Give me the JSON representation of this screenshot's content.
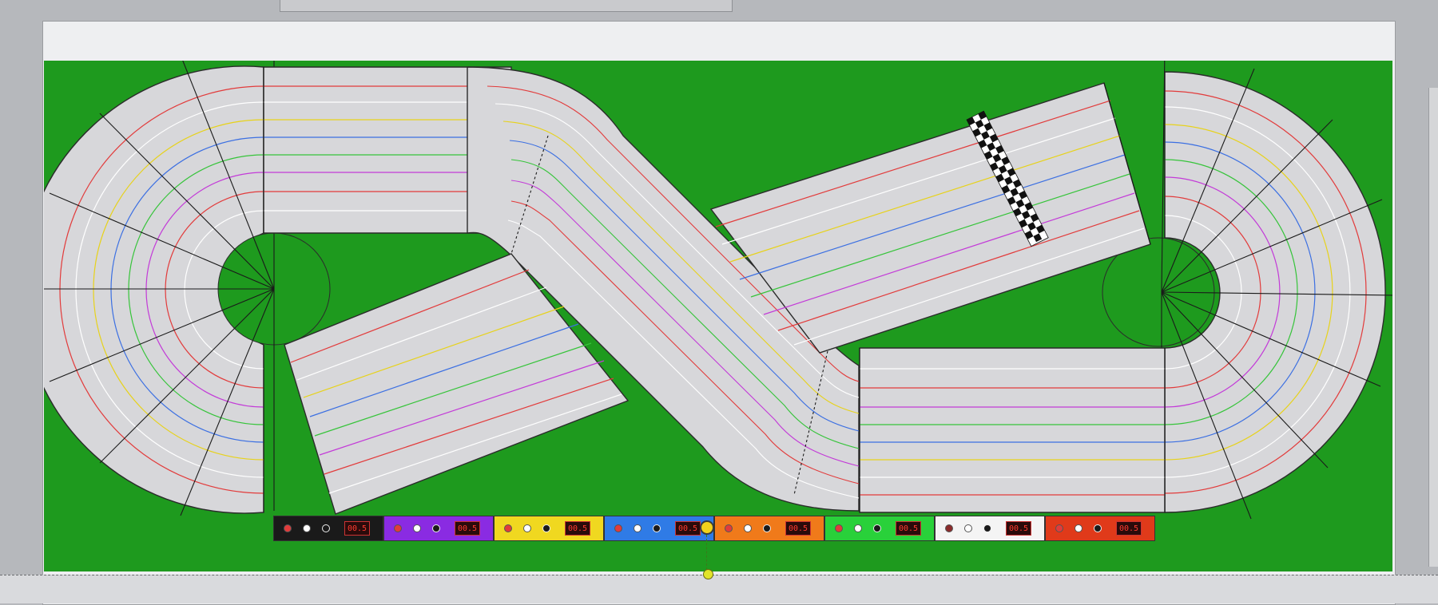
{
  "colors": {
    "grass": "#1e9a1e",
    "track": "#d7d7da",
    "track_edge": "#2b2b2b",
    "lane_lines": [
      "#e23b3b",
      "#ffffff",
      "#e7d21a",
      "#3b6fe2",
      "#36c43a",
      "#c33bd8"
    ],
    "finish_dark": "#111111",
    "finish_light": "#ffffff"
  },
  "lanes": [
    {
      "id": "lane-1",
      "color": "#1a1a1a",
      "dots": [
        "#e23b3b",
        "#ffffff",
        "#1a1a1a"
      ],
      "timer": "00.5"
    },
    {
      "id": "lane-2",
      "color": "#8a2be2",
      "dots": [
        "#e23b3b",
        "#ffffff",
        "#1a1a1a"
      ],
      "timer": "00.5"
    },
    {
      "id": "lane-3",
      "color": "#f0d820",
      "dots": [
        "#e23b3b",
        "#ffffff",
        "#1a1a1a"
      ],
      "timer": "00.5"
    },
    {
      "id": "lane-4",
      "color": "#2f7be6",
      "dots": [
        "#e23b3b",
        "#ffffff",
        "#1a1a1a"
      ],
      "timer": "00.5"
    },
    {
      "id": "lane-5",
      "color": "#f07a1a",
      "dots": [
        "#e23b3b",
        "#ffffff",
        "#1a1a1a"
      ],
      "timer": "00.5"
    },
    {
      "id": "lane-6",
      "color": "#29d13a",
      "dots": [
        "#e23b3b",
        "#ffffff",
        "#1a1a1a"
      ],
      "timer": "00.5"
    },
    {
      "id": "lane-7",
      "color": "#f4f4f4",
      "dots": [
        "#8b2b2b",
        "#ffffff",
        "#1a1a1a"
      ],
      "timer": "00.5"
    },
    {
      "id": "lane-8",
      "color": "#e03a1a",
      "dots": [
        "#e23b3b",
        "#ffffff",
        "#1a1a1a"
      ],
      "timer": "00.5"
    }
  ],
  "icons": {
    "handle": "drag-handle-icon",
    "anchor": "anchor-point-icon"
  }
}
